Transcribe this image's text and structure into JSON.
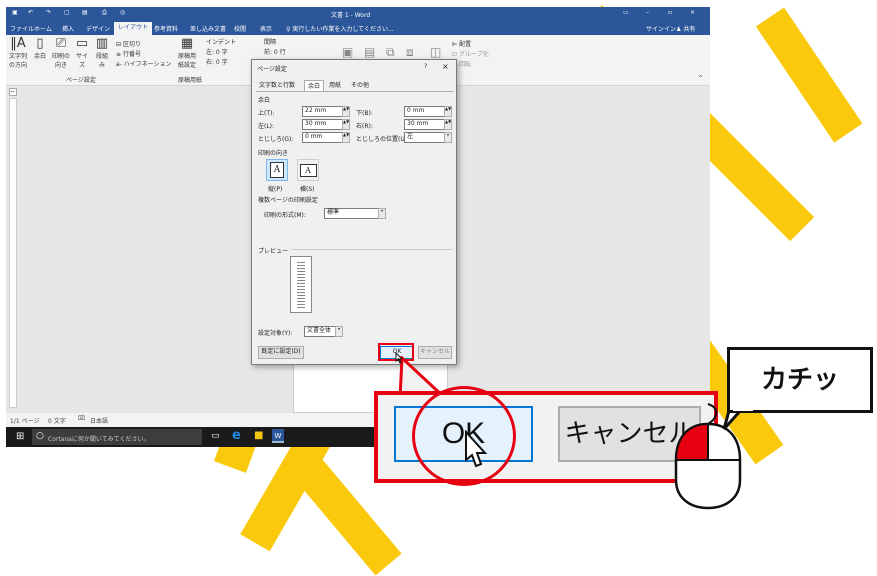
{
  "word": {
    "title": "文書 1 - Word",
    "signin": "サインイン",
    "share": "共有",
    "tell_me": "実行したい作業を入力してください...",
    "menu": [
      "ファイル",
      "ホーム",
      "挿入",
      "デザイン",
      "レイアウト",
      "参考資料",
      "差し込み文書",
      "校閲",
      "表示"
    ],
    "active_menu": "レイアウト",
    "ribbon": {
      "text_direction": "文字列の方向",
      "margins": "余白",
      "orientation": "印刷の向き",
      "size": "サイズ",
      "columns": "段組み",
      "breaks": "区切り",
      "line_numbers": "行番号",
      "hyphenation": "ハイフネーション",
      "group_page_setup": "ページ設定",
      "manuscript": "原稿用紙設定",
      "group_manuscript": "原稿用紙",
      "indent": "インデント",
      "spacing": "間隔",
      "indent_left": "左: 0 字",
      "indent_right": "右: 0 字",
      "spacing_before": "前: 0 行",
      "position": "配置",
      "group": "グループ化",
      "rotate": "回転"
    },
    "status": {
      "page": "1/1 ページ",
      "words": "0 文字",
      "language": "日本語"
    },
    "taskbar": {
      "cortana": "Cortanaに何か聞いてみてください。"
    }
  },
  "dialog": {
    "title": "ページ設定",
    "help": "?",
    "close": "×",
    "tabs": [
      "文字数と行数",
      "余白",
      "用紙",
      "その他"
    ],
    "selected_tab": "余白",
    "margins_heading": "余白",
    "top_label": "上(T):",
    "top_value": "22 mm",
    "bottom_label": "下(B):",
    "bottom_value": "0 mm",
    "left_label": "左(L):",
    "left_value": "30 mm",
    "right_label": "右(R):",
    "right_value": "30 mm",
    "gutter_label": "とじしろ(G):",
    "gutter_value": "0 mm",
    "gutter_pos_label": "とじしろの位置(U):",
    "gutter_pos_value": "左",
    "orientation_heading": "印刷の向き",
    "portrait": "縦(P)",
    "landscape": "横(S)",
    "multi_heading": "複数ページの印刷設定",
    "multi_label": "印刷の形式(M):",
    "multi_value": "標準",
    "preview_heading": "プレビュー",
    "apply_label": "設定対象(Y):",
    "apply_value": "文書全体",
    "default_button": "既定に設定(D)",
    "ok_button": "OK",
    "cancel_button": "キャンセル"
  },
  "callout": {
    "ok": "OK",
    "cancel": "キャンセル",
    "sound": "カチッ"
  },
  "colors": {
    "word_blue": "#2b579a",
    "highlight_red": "#e60012",
    "stroke_yellow": "#fbc90b",
    "ok_focus": "#0078d7"
  }
}
